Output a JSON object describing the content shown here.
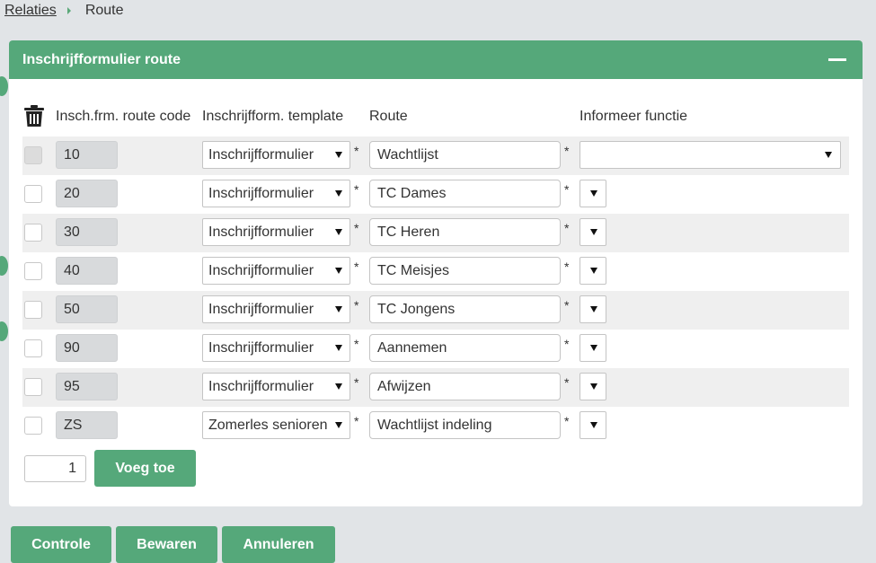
{
  "breadcrumb": {
    "parent": "Relaties",
    "current": "Route"
  },
  "panel": {
    "title": "Inschrijfformulier route",
    "columns": {
      "code": "Insch.frm. route code",
      "template": "Inschrijfform. template",
      "route": "Route",
      "function": "Informeer functie"
    },
    "required_mark": "*",
    "rows": [
      {
        "code": "10",
        "template": "Inschrijfformulier",
        "route": "Wachtlijst",
        "function": ""
      },
      {
        "code": "20",
        "template": "Inschrijfformulier",
        "route": "TC Dames",
        "function": ""
      },
      {
        "code": "30",
        "template": "Inschrijfformulier",
        "route": "TC Heren",
        "function": ""
      },
      {
        "code": "40",
        "template": "Inschrijfformulier",
        "route": "TC Meisjes",
        "function": ""
      },
      {
        "code": "50",
        "template": "Inschrijfformulier",
        "route": "TC Jongens",
        "function": ""
      },
      {
        "code": "90",
        "template": "Inschrijfformulier",
        "route": "Aannemen",
        "function": ""
      },
      {
        "code": "95",
        "template": "Inschrijfformulier",
        "route": "Afwijzen",
        "function": ""
      },
      {
        "code": "ZS",
        "template": "Zomerles senioren",
        "route": "Wachtlijst indeling",
        "function": ""
      }
    ],
    "add_count": "1",
    "add_button": "Voeg toe"
  },
  "footer": {
    "check": "Controle",
    "save": "Bewaren",
    "cancel": "Annuleren"
  },
  "colors": {
    "accent": "#55a87a",
    "background": "#e1e4e7",
    "row_shade": "#efefef"
  },
  "icons": {
    "delete": "trash-icon",
    "collapse": "minus-icon",
    "breadcrumb_separator": "caret-right-icon"
  }
}
